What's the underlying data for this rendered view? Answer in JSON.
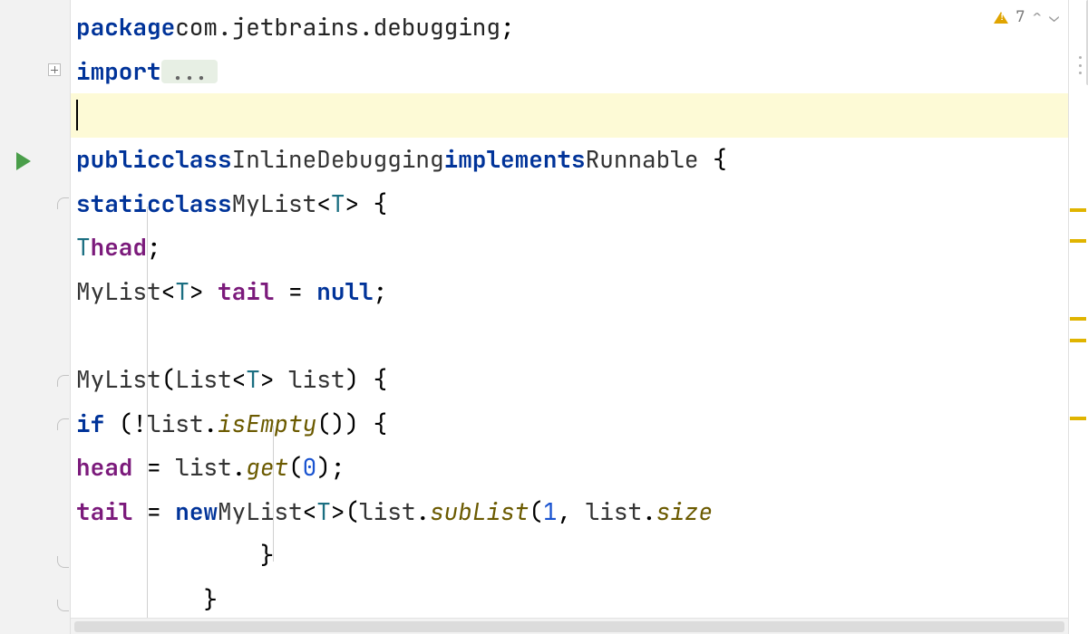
{
  "inspection": {
    "count": "7"
  },
  "code": {
    "package_kw": "package",
    "package_name": "com.jetbrains.debugging",
    "import_kw": "import",
    "ellipsis": "...",
    "class_decl": {
      "public": "public",
      "class": "class",
      "name": "InlineDebugging",
      "implements": "implements",
      "iface": "Runnable"
    },
    "inner": {
      "static": "static",
      "class": "class",
      "name": "MyList",
      "tparam": "T"
    },
    "fields": {
      "head_type": "T",
      "head_name": "head",
      "tail_type": "MyList",
      "tail_tparam": "T",
      "tail_name": "tail",
      "null_kw": "null"
    },
    "ctor": {
      "name": "MyList",
      "param_type": "List",
      "param_tparam": "T",
      "param_name": "list",
      "if_kw": "if",
      "isEmpty": "isEmpty",
      "head": "head",
      "get": "get",
      "zero": "0",
      "tail": "tail",
      "new_kw": "new",
      "subList": "subList",
      "one": "1",
      "size": "size"
    }
  },
  "markers": [
    230,
    264,
    350,
    374,
    460
  ]
}
